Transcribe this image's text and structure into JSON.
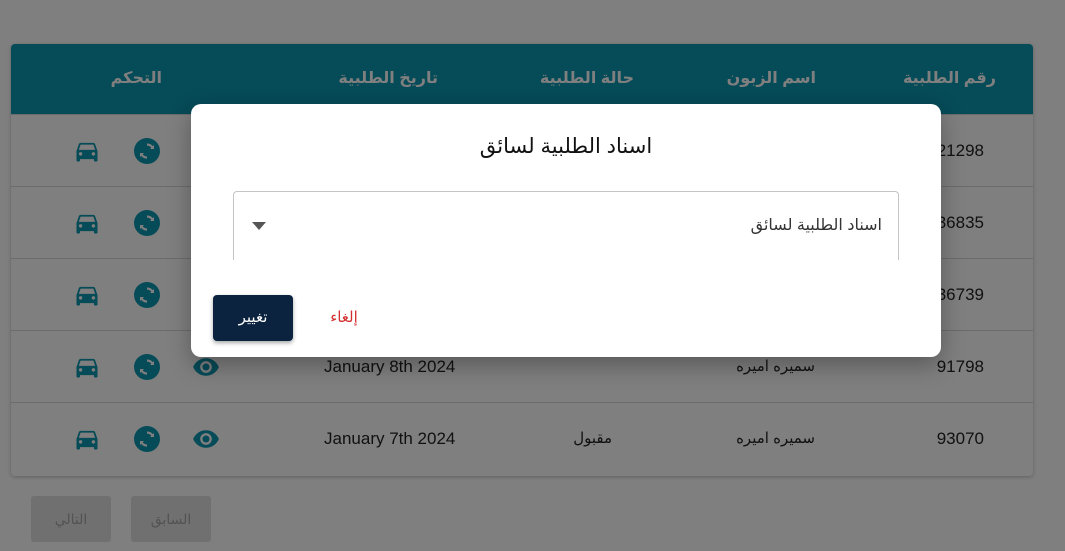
{
  "table": {
    "headers": {
      "order_no": "رقم الطلبية",
      "customer": "اسم الزبون",
      "status": "حالة الطلبية",
      "date": "تاريخ الطلبية",
      "control": "التحكم"
    },
    "rows": [
      {
        "order_no": "21298",
        "customer": "",
        "status": "",
        "date": ""
      },
      {
        "order_no": "36835",
        "customer": "",
        "status": "",
        "date": ""
      },
      {
        "order_no": "36739",
        "customer": "",
        "status": "",
        "date": ""
      },
      {
        "order_no": "91798",
        "customer": "سميره اميره",
        "status": "",
        "date": "January 8th 2024"
      },
      {
        "order_no": "93070",
        "customer": "سميره اميره",
        "status": "مقبول",
        "date": "January 7th 2024"
      }
    ],
    "control_icons": [
      "car-icon",
      "refresh-icon",
      "eye-icon"
    ]
  },
  "pagination": {
    "previous": "السابق",
    "next": "التالي"
  },
  "dialog": {
    "title": "اسناد الطلبية لسائق",
    "select_label": "اسناد الطلبية لسائق",
    "change_button": "تغيير",
    "cancel_button": "إلغاء"
  },
  "colors": {
    "header_bg": "#0d96b0",
    "icon": "#0d96b0",
    "primary_button": "#0c2340",
    "cancel_text": "#d32f2f"
  }
}
